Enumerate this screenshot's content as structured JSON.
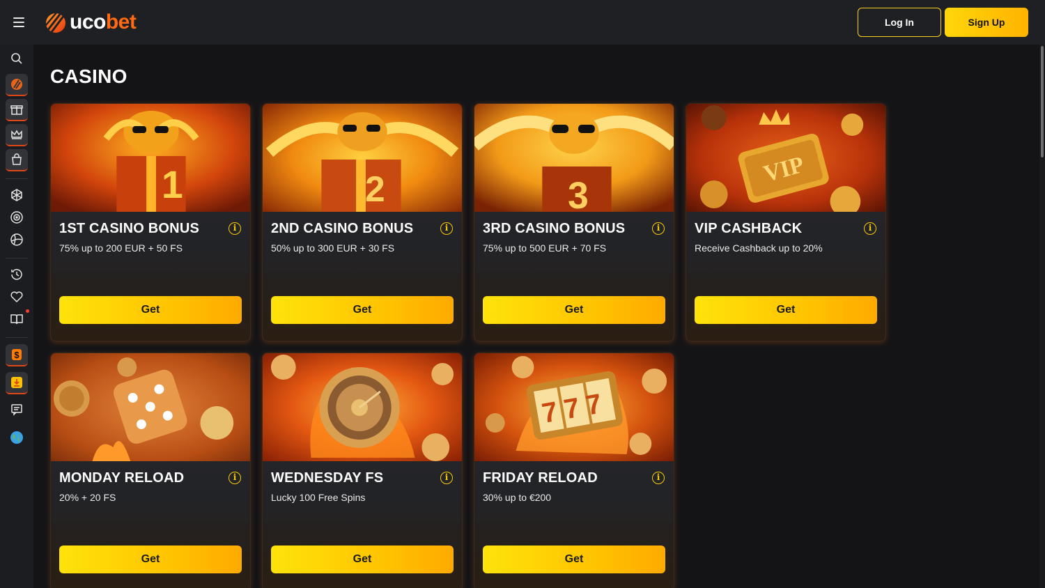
{
  "header": {
    "brand_part1": "uco",
    "brand_part2": "bet",
    "login_label": "Log In",
    "signup_label": "Sign Up"
  },
  "main": {
    "title": "CASINO"
  },
  "cards": [
    {
      "title": "1ST CASINO BONUS",
      "subtitle": "75% up to 200 EUR + 50 FS",
      "button": "Get",
      "image_number": "1"
    },
    {
      "title": "2ND CASINO BONUS",
      "subtitle": "50% up to 300 EUR + 30 FS",
      "button": "Get",
      "image_number": "2"
    },
    {
      "title": "3RD CASINO BONUS",
      "subtitle": "75% up to 500 EUR + 70 FS",
      "button": "Get",
      "image_number": "3"
    },
    {
      "title": "VIP CASHBACK",
      "subtitle": "Receive Cashback up to 20%",
      "button": "Get",
      "image_number": "VIP"
    },
    {
      "title": "MONDAY RELOAD",
      "subtitle": "20% + 20 FS",
      "button": "Get"
    },
    {
      "title": "WEDNESDAY FS",
      "subtitle": "Lucky 100 Free Spins",
      "button": "Get"
    },
    {
      "title": "FRIDAY RELOAD",
      "subtitle": "30% up to €200",
      "button": "Get",
      "image_number": "777"
    }
  ],
  "sidebar": {
    "icons": [
      "search-icon",
      "casino-icon",
      "gift-icon",
      "crown-icon",
      "shop-icon",
      "poker-chip-icon",
      "target-icon",
      "sports-ball-icon",
      "history-icon",
      "heart-icon",
      "book-icon",
      "dollar-icon",
      "download-icon",
      "chat-icon",
      "globe-icon"
    ]
  },
  "colors": {
    "accent": "#ffcc00",
    "brand_orange": "#ff6a13",
    "background": "#141417",
    "header": "#1f2024"
  }
}
